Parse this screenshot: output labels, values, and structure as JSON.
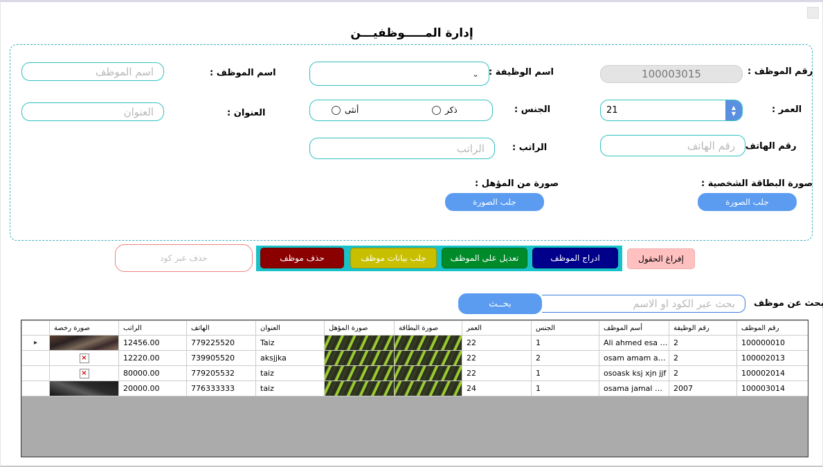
{
  "title": "إدارة المـــــوظفيـــن",
  "labels": {
    "emp_id": "رقم الموظف :",
    "job_name": "اسم الوظيفة :",
    "emp_name": "اسم الموظف :",
    "age": "العمر :",
    "gender": "الجنس :",
    "address": "العنوان :",
    "phone": "رقم الهاتف :",
    "salary": "الراتب :",
    "id_card_image": "صورة البطاقة الشخصية :",
    "qualification_image": "صورة من المؤهل :",
    "search": "بحث عن موظف"
  },
  "fields": {
    "emp_id_value": "100003015",
    "emp_name_placeholder": "اسم الموظف",
    "address_placeholder": "العنوان",
    "phone_placeholder": "رقم الهاتف",
    "salary_placeholder": "الراتب",
    "age_value": "21",
    "job_name_value": "",
    "search_placeholder": "بحث عبر الكود او الاسم"
  },
  "gender_options": {
    "male": "ذكر",
    "female": "أنثى"
  },
  "buttons": {
    "fetch_image_card": "جلب الصورة",
    "fetch_image_qual": "جلب الصورة",
    "clear": "إفراغ الحقول",
    "insert": "ادراج الموظف",
    "edit": "تعديل على الموظف",
    "fetch_data": "جلب بيانات موظف",
    "delete": "حذف موظف",
    "delete_by_code": "حذف عبر كود",
    "search": "بحــث"
  },
  "colors": {
    "accent_teal": "#18c2c8",
    "insert": "#00008b",
    "edit": "#008b2a",
    "fetch": "#c8bf00",
    "delete": "#8b0000",
    "pill_blue": "#5b9cf0"
  },
  "table": {
    "columns": [
      "صورة رخصة",
      "الراتب",
      "الهاتف",
      "العنوان",
      "صورة المؤهل",
      "صورة البطاقة",
      "العمر",
      "الجنس",
      "أسم الموظف",
      "رقم الوظيفة",
      "رقم الموظف"
    ],
    "rows": [
      {
        "license": "photo-dark",
        "salary": "12456.00",
        "phone": "779225520",
        "address": "Taiz",
        "qual": "photo-green",
        "card": "photo-green",
        "age": "22",
        "gender": "1",
        "name": "Ali ahmed esa ali",
        "job": "2",
        "id": "100000010",
        "current": true
      },
      {
        "license": "broken-image-icon",
        "salary": "12220.00",
        "phone": "739905520",
        "address": "aksjjka",
        "qual": "photo-green",
        "card": "photo-green",
        "age": "22",
        "gender": "2",
        "name": "osam amam ama...",
        "job": "2",
        "id": "100002013",
        "current": false
      },
      {
        "license": "broken-image-icon",
        "salary": "80000.00",
        "phone": "779205532",
        "address": "taiz",
        "qual": "photo-green",
        "card": "photo-green",
        "age": "22",
        "gender": "1",
        "name": "osoask ksj xjn jjf",
        "job": "2",
        "id": "100002014",
        "current": false
      },
      {
        "license": "photo-black",
        "salary": "20000.00",
        "phone": "776333333",
        "address": "taiz",
        "qual": "photo-green",
        "card": "photo-green",
        "age": "24",
        "gender": "1",
        "name": "osama jamal mon...",
        "job": "2007",
        "id": "100003014",
        "current": false
      }
    ]
  }
}
